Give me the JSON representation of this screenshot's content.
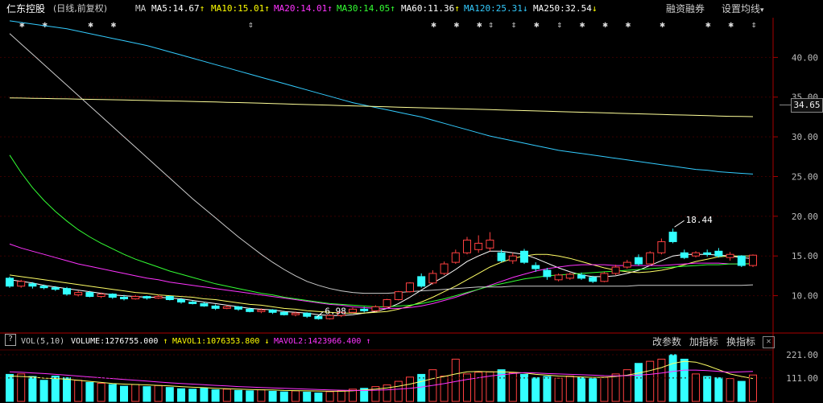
{
  "header": {
    "stock_name": "仁东控股",
    "period_info": "(日线,前复权)",
    "ma_label": "MA",
    "ma_items": [
      {
        "label": "MA5:14.67",
        "arrow": "↑",
        "color": "#ffffff"
      },
      {
        "label": "MA10:15.01",
        "arrow": "↑",
        "color": "#ffff00"
      },
      {
        "label": "MA20:14.01",
        "arrow": "↑",
        "color": "#ff33ff"
      },
      {
        "label": "MA30:14.05",
        "arrow": "↑",
        "color": "#33ff33"
      },
      {
        "label": "MA60:11.36",
        "arrow": "↑",
        "color": "#ffffff"
      },
      {
        "label": "MA120:25.31",
        "arrow": "↓",
        "color": "#33ccff"
      },
      {
        "label": "MA250:32.54",
        "arrow": "↓",
        "color": "#ffffff"
      }
    ],
    "margin_trading_button": "融资融券",
    "ma_settings_button": "设置均线"
  },
  "price_axis": {
    "ticks": [
      "40.00",
      "35.00",
      "30.00",
      "25.00",
      "20.00",
      "15.00",
      "10.00"
    ],
    "current_price_box": "34.65"
  },
  "annotations": {
    "high_label": "18.44",
    "low_label": "6.98"
  },
  "volume_header": {
    "vol_label": "VOL(5,10)",
    "volume_label": "VOLUME:1276755.000",
    "volume_arrow": "↑",
    "mavol1_label": "MAVOL1:1076353.800",
    "mavol1_arrow": "↓",
    "mavol2_label": "MAVOL2:1423966.400",
    "mavol2_arrow": "↑",
    "modify_params_button": "改参数",
    "add_indicator_button": "加指标",
    "switch_indicator_button": "换指标",
    "close_glyph": "✕",
    "help_glyph": "?"
  },
  "volume_axis": {
    "ticks": [
      "221.00",
      "111.00"
    ]
  },
  "event_markers": {
    "symbols": [
      "✱",
      "✱",
      "✱",
      "✱",
      "⇕",
      "✱",
      "✱",
      "✱",
      "⇕",
      "⇕",
      "✱",
      "⇕",
      "✱",
      "✱",
      "✱",
      "✱",
      "✱",
      "✱",
      "⇕"
    ]
  },
  "chart_data": {
    "type": "candlestick",
    "price_ylim": [
      5.5,
      45
    ],
    "candles": [
      {
        "o": 12.2,
        "c": 11.2,
        "h": 12.4,
        "l": 11.0
      },
      {
        "o": 11.2,
        "c": 11.8,
        "h": 12.0,
        "l": 11.0
      },
      {
        "o": 11.5,
        "c": 11.2,
        "h": 11.7,
        "l": 10.9
      },
      {
        "o": 11.2,
        "c": 11.0,
        "h": 11.4,
        "l": 10.8
      },
      {
        "o": 11.0,
        "c": 10.8,
        "h": 11.2,
        "l": 10.6
      },
      {
        "o": 10.9,
        "c": 10.2,
        "h": 11.1,
        "l": 10.0
      },
      {
        "o": 10.1,
        "c": 10.4,
        "h": 10.6,
        "l": 9.9
      },
      {
        "o": 10.4,
        "c": 9.9,
        "h": 10.6,
        "l": 9.8
      },
      {
        "o": 9.9,
        "c": 10.2,
        "h": 10.4,
        "l": 9.7
      },
      {
        "o": 10.2,
        "c": 9.8,
        "h": 10.3,
        "l": 9.6
      },
      {
        "o": 9.8,
        "c": 9.6,
        "h": 10.1,
        "l": 9.4
      },
      {
        "o": 9.6,
        "c": 9.9,
        "h": 10.1,
        "l": 9.5
      },
      {
        "o": 9.9,
        "c": 9.7,
        "h": 10.0,
        "l": 9.5
      },
      {
        "o": 9.7,
        "c": 9.9,
        "h": 10.1,
        "l": 9.6
      },
      {
        "o": 9.9,
        "c": 9.5,
        "h": 10.0,
        "l": 9.4
      },
      {
        "o": 9.5,
        "c": 9.2,
        "h": 9.7,
        "l": 9.0
      },
      {
        "o": 9.2,
        "c": 9.0,
        "h": 9.4,
        "l": 8.9
      },
      {
        "o": 9.0,
        "c": 8.7,
        "h": 9.2,
        "l": 8.6
      },
      {
        "o": 8.7,
        "c": 8.4,
        "h": 8.9,
        "l": 8.2
      },
      {
        "o": 8.4,
        "c": 8.6,
        "h": 8.8,
        "l": 8.3
      },
      {
        "o": 8.6,
        "c": 8.3,
        "h": 8.7,
        "l": 8.1
      },
      {
        "o": 8.3,
        "c": 8.0,
        "h": 8.5,
        "l": 7.9
      },
      {
        "o": 8.0,
        "c": 8.2,
        "h": 8.4,
        "l": 7.8
      },
      {
        "o": 8.2,
        "c": 7.9,
        "h": 8.3,
        "l": 7.7
      },
      {
        "o": 7.9,
        "c": 7.6,
        "h": 8.1,
        "l": 7.5
      },
      {
        "o": 7.6,
        "c": 7.8,
        "h": 8.0,
        "l": 7.4
      },
      {
        "o": 7.8,
        "c": 7.4,
        "h": 7.9,
        "l": 7.2
      },
      {
        "o": 7.4,
        "c": 7.1,
        "h": 7.6,
        "l": 6.98
      },
      {
        "o": 7.1,
        "c": 7.5,
        "h": 7.7,
        "l": 7.0
      },
      {
        "o": 7.5,
        "c": 7.9,
        "h": 8.0,
        "l": 7.3
      },
      {
        "o": 7.9,
        "c": 8.3,
        "h": 8.5,
        "l": 7.8
      },
      {
        "o": 8.3,
        "c": 8.1,
        "h": 8.6,
        "l": 7.9
      },
      {
        "o": 8.1,
        "c": 8.6,
        "h": 8.8,
        "l": 8.0
      },
      {
        "o": 8.6,
        "c": 9.5,
        "h": 9.6,
        "l": 8.5
      },
      {
        "o": 9.5,
        "c": 10.5,
        "h": 10.6,
        "l": 9.4
      },
      {
        "o": 10.5,
        "c": 11.6,
        "h": 11.7,
        "l": 10.4
      },
      {
        "o": 12.4,
        "c": 11.2,
        "h": 12.8,
        "l": 11.0
      },
      {
        "o": 11.6,
        "c": 12.8,
        "h": 13.2,
        "l": 11.4
      },
      {
        "o": 12.8,
        "c": 14.0,
        "h": 14.3,
        "l": 12.6
      },
      {
        "o": 14.2,
        "c": 15.4,
        "h": 15.8,
        "l": 14.0
      },
      {
        "o": 15.4,
        "c": 17.0,
        "h": 17.4,
        "l": 15.2
      },
      {
        "o": 15.8,
        "c": 16.6,
        "h": 17.6,
        "l": 15.4
      },
      {
        "o": 16.0,
        "c": 17.0,
        "h": 18.0,
        "l": 15.6
      },
      {
        "o": 15.4,
        "c": 14.4,
        "h": 15.8,
        "l": 14.2
      },
      {
        "o": 14.4,
        "c": 15.0,
        "h": 15.4,
        "l": 14.0
      },
      {
        "o": 15.6,
        "c": 14.2,
        "h": 15.9,
        "l": 14.0
      },
      {
        "o": 13.8,
        "c": 13.4,
        "h": 14.2,
        "l": 13.0
      },
      {
        "o": 13.2,
        "c": 12.4,
        "h": 13.5,
        "l": 12.0
      },
      {
        "o": 12.0,
        "c": 12.6,
        "h": 12.8,
        "l": 11.8
      },
      {
        "o": 12.2,
        "c": 12.7,
        "h": 12.9,
        "l": 12.0
      },
      {
        "o": 12.6,
        "c": 12.2,
        "h": 12.9,
        "l": 12.0
      },
      {
        "o": 12.3,
        "c": 11.8,
        "h": 12.5,
        "l": 11.6
      },
      {
        "o": 11.8,
        "c": 12.8,
        "h": 13.0,
        "l": 11.7
      },
      {
        "o": 12.8,
        "c": 13.6,
        "h": 13.9,
        "l": 12.6
      },
      {
        "o": 13.6,
        "c": 14.2,
        "h": 14.5,
        "l": 13.4
      },
      {
        "o": 14.8,
        "c": 14.0,
        "h": 15.2,
        "l": 13.8
      },
      {
        "o": 14.0,
        "c": 15.4,
        "h": 15.6,
        "l": 13.9
      },
      {
        "o": 15.4,
        "c": 16.8,
        "h": 17.2,
        "l": 15.2
      },
      {
        "o": 18.0,
        "c": 16.8,
        "h": 18.44,
        "l": 16.6
      },
      {
        "o": 15.4,
        "c": 14.8,
        "h": 15.8,
        "l": 14.6
      },
      {
        "o": 15.0,
        "c": 15.4,
        "h": 15.6,
        "l": 14.8
      },
      {
        "o": 15.4,
        "c": 15.2,
        "h": 15.8,
        "l": 14.9
      },
      {
        "o": 15.6,
        "c": 15.0,
        "h": 16.0,
        "l": 14.8
      },
      {
        "o": 14.8,
        "c": 15.2,
        "h": 15.5,
        "l": 14.4
      },
      {
        "o": 15.0,
        "c": 13.8,
        "h": 15.1,
        "l": 13.6
      },
      {
        "o": 13.8,
        "c": 15.1,
        "h": 15.2,
        "l": 13.6
      }
    ],
    "ma_lines": {
      "MA5": [
        12.0,
        11.8,
        11.6,
        11.3,
        11.1,
        10.9,
        10.7,
        10.5,
        10.3,
        10.1,
        10.0,
        9.9,
        9.8,
        9.8,
        9.7,
        9.6,
        9.4,
        9.2,
        9.0,
        8.8,
        8.6,
        8.4,
        8.3,
        8.2,
        8.0,
        7.9,
        7.8,
        7.6,
        7.5,
        7.5,
        7.6,
        7.8,
        8.0,
        8.4,
        9.0,
        9.8,
        10.7,
        11.6,
        12.4,
        13.3,
        14.3,
        15.0,
        15.6,
        15.6,
        15.4,
        15.2,
        14.7,
        14.1,
        13.5,
        13.0,
        12.6,
        12.4,
        12.4,
        12.5,
        12.8,
        13.2,
        13.8,
        14.4,
        15.0,
        15.2,
        15.2,
        15.2,
        15.1,
        15.0,
        14.8,
        14.67
      ],
      "MA10": [
        12.6,
        12.4,
        12.2,
        12.0,
        11.8,
        11.6,
        11.4,
        11.2,
        11.0,
        10.8,
        10.6,
        10.4,
        10.3,
        10.1,
        10.0,
        9.9,
        9.8,
        9.6,
        9.5,
        9.3,
        9.1,
        8.9,
        8.8,
        8.6,
        8.4,
        8.3,
        8.1,
        8.0,
        7.9,
        7.8,
        7.8,
        7.8,
        7.9,
        8.0,
        8.3,
        8.7,
        9.2,
        9.8,
        10.5,
        11.2,
        12.0,
        12.8,
        13.6,
        14.2,
        14.7,
        15.0,
        15.2,
        15.2,
        15.0,
        14.7,
        14.3,
        13.9,
        13.5,
        13.2,
        13.0,
        12.9,
        13.0,
        13.2,
        13.5,
        13.9,
        14.3,
        14.6,
        14.9,
        15.0,
        15.0,
        15.01
      ],
      "MA20": [
        16.5,
        16.0,
        15.6,
        15.2,
        14.8,
        14.4,
        14.0,
        13.7,
        13.4,
        13.1,
        12.8,
        12.5,
        12.2,
        12.0,
        11.7,
        11.5,
        11.3,
        11.1,
        10.9,
        10.7,
        10.5,
        10.3,
        10.1,
        9.9,
        9.7,
        9.5,
        9.3,
        9.1,
        8.9,
        8.8,
        8.6,
        8.5,
        8.4,
        8.4,
        8.4,
        8.5,
        8.7,
        9.0,
        9.4,
        9.8,
        10.3,
        10.8,
        11.3,
        11.8,
        12.3,
        12.7,
        13.1,
        13.4,
        13.6,
        13.8,
        13.9,
        13.9,
        13.9,
        13.8,
        13.8,
        13.8,
        13.8,
        13.8,
        13.9,
        14.0,
        14.1,
        14.1,
        14.1,
        14.0,
        14.0,
        14.01
      ],
      "MA30": [
        27.7,
        25.5,
        23.6,
        22.0,
        20.6,
        19.4,
        18.3,
        17.4,
        16.6,
        15.9,
        15.2,
        14.6,
        14.1,
        13.6,
        13.1,
        12.7,
        12.3,
        11.9,
        11.5,
        11.2,
        10.9,
        10.6,
        10.3,
        10.1,
        9.8,
        9.6,
        9.4,
        9.2,
        9.0,
        8.9,
        8.8,
        8.7,
        8.6,
        8.6,
        8.7,
        8.8,
        9.0,
        9.3,
        9.6,
        10.0,
        10.4,
        10.8,
        11.2,
        11.5,
        11.8,
        12.1,
        12.3,
        12.5,
        12.6,
        12.7,
        12.8,
        12.9,
        13.0,
        13.1,
        13.2,
        13.3,
        13.4,
        13.5,
        13.6,
        13.7,
        13.8,
        13.9,
        13.9,
        14.0,
        14.0,
        14.05
      ],
      "MA60": [
        43.0,
        41.7,
        40.4,
        39.1,
        37.8,
        36.5,
        35.2,
        33.9,
        32.6,
        31.3,
        30.0,
        28.7,
        27.4,
        26.1,
        24.8,
        23.5,
        22.2,
        21.0,
        19.8,
        18.6,
        17.4,
        16.3,
        15.2,
        14.2,
        13.3,
        12.5,
        11.8,
        11.3,
        10.9,
        10.6,
        10.4,
        10.3,
        10.3,
        10.3,
        10.4,
        10.5,
        10.6,
        10.7,
        10.8,
        10.9,
        11.0,
        11.1,
        11.1,
        11.1,
        11.2,
        11.2,
        11.2,
        11.2,
        11.2,
        11.2,
        11.2,
        11.2,
        11.2,
        11.2,
        11.2,
        11.3,
        11.3,
        11.3,
        11.3,
        11.3,
        11.3,
        11.3,
        11.3,
        11.3,
        11.3,
        11.36
      ],
      "MA120": [
        44.6,
        44.4,
        44.2,
        44.0,
        43.8,
        43.6,
        43.3,
        43.0,
        42.7,
        42.4,
        42.1,
        41.8,
        41.5,
        41.1,
        40.7,
        40.3,
        39.9,
        39.5,
        39.1,
        38.7,
        38.3,
        37.9,
        37.5,
        37.1,
        36.7,
        36.3,
        35.9,
        35.5,
        35.1,
        34.7,
        34.3,
        34.0,
        33.7,
        33.4,
        33.1,
        32.8,
        32.5,
        32.1,
        31.7,
        31.3,
        30.9,
        30.5,
        30.1,
        29.8,
        29.5,
        29.2,
        28.9,
        28.6,
        28.3,
        28.1,
        27.9,
        27.7,
        27.5,
        27.3,
        27.1,
        26.9,
        26.7,
        26.5,
        26.3,
        26.1,
        25.9,
        25.8,
        25.6,
        25.5,
        25.4,
        25.31
      ],
      "MA250": [
        34.9,
        34.88,
        34.85,
        34.83,
        34.8,
        34.78,
        34.75,
        34.72,
        34.7,
        34.67,
        34.64,
        34.61,
        34.58,
        34.55,
        34.52,
        34.49,
        34.46,
        34.42,
        34.39,
        34.35,
        34.31,
        34.27,
        34.23,
        34.19,
        34.15,
        34.1,
        34.06,
        34.02,
        33.98,
        33.94,
        33.9,
        33.86,
        33.82,
        33.78,
        33.74,
        33.7,
        33.66,
        33.62,
        33.58,
        33.54,
        33.5,
        33.46,
        33.42,
        33.38,
        33.34,
        33.3,
        33.26,
        33.22,
        33.18,
        33.14,
        33.1,
        33.06,
        33.02,
        32.98,
        32.94,
        32.9,
        32.86,
        32.82,
        32.78,
        32.74,
        32.7,
        32.66,
        32.62,
        32.58,
        32.56,
        32.54
      ]
    },
    "volume_ylim": [
      0,
      240
    ],
    "volumes": [
      128,
      130,
      118,
      100,
      120,
      112,
      100,
      90,
      86,
      80,
      72,
      80,
      70,
      75,
      66,
      60,
      58,
      62,
      55,
      58,
      52,
      50,
      55,
      48,
      45,
      50,
      44,
      40,
      46,
      50,
      58,
      62,
      70,
      78,
      95,
      115,
      128,
      150,
      120,
      200,
      130,
      138,
      140,
      150,
      135,
      128,
      112,
      118,
      110,
      120,
      112,
      108,
      115,
      130,
      150,
      180,
      190,
      200,
      221,
      200,
      130,
      118,
      112,
      108,
      95,
      125
    ],
    "mavol1": [
      120,
      118,
      115,
      110,
      108,
      105,
      100,
      95,
      90,
      85,
      82,
      80,
      78,
      76,
      73,
      70,
      67,
      65,
      62,
      60,
      58,
      56,
      55,
      54,
      52,
      51,
      50,
      49,
      48,
      48,
      50,
      54,
      58,
      64,
      72,
      82,
      94,
      108,
      118,
      130,
      140,
      142,
      140,
      140,
      138,
      135,
      128,
      124,
      120,
      118,
      116,
      114,
      114,
      118,
      124,
      134,
      146,
      160,
      180,
      190,
      186,
      170,
      150,
      130,
      118,
      108
    ],
    "mavol2": [
      140,
      138,
      135,
      132,
      128,
      124,
      120,
      116,
      112,
      108,
      104,
      100,
      96,
      92,
      88,
      85,
      82,
      79,
      76,
      73,
      70,
      68,
      66,
      64,
      62,
      60,
      58,
      56,
      54,
      53,
      52,
      52,
      53,
      55,
      58,
      62,
      68,
      76,
      84,
      94,
      104,
      112,
      120,
      126,
      132,
      136,
      135,
      132,
      130,
      128,
      126,
      124,
      122,
      121,
      122,
      124,
      128,
      134,
      142,
      148,
      148,
      146,
      142,
      138,
      140,
      142
    ]
  }
}
